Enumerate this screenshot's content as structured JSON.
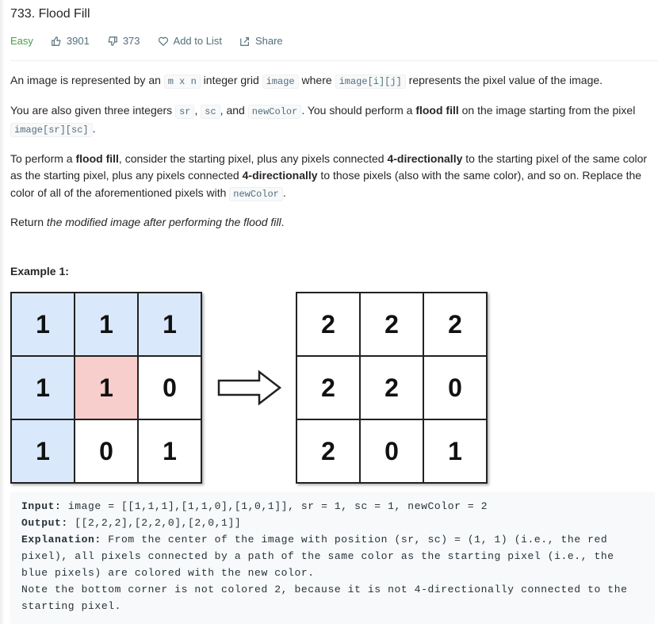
{
  "problem": {
    "title": "733. Flood Fill",
    "difficulty": "Easy",
    "likes": "3901",
    "dislikes": "373",
    "add_to_list": "Add to List",
    "share": "Share"
  },
  "description": {
    "p1": [
      "An image is represented by an ",
      "m x n",
      " integer grid ",
      "image",
      " where ",
      "image[i][j]",
      " represents the pixel value of the image."
    ],
    "p2": [
      "You are also given three integers ",
      "sr",
      ", ",
      "sc",
      ", and ",
      "newColor",
      ". You should perform a ",
      "flood fill",
      " on the image starting from the pixel ",
      "image[sr][sc]",
      "."
    ],
    "p3": [
      "To perform a ",
      "flood fill",
      ", consider the starting pixel, plus any pixels connected ",
      "4-directionally",
      " to the starting pixel of the same color as the starting pixel, plus any pixels connected ",
      "4-directionally",
      " to those pixels (also with the same color), and so on. Replace the color of all of the aforementioned pixels with ",
      "newColor",
      "."
    ],
    "p4": [
      "Return ",
      "the modified image after performing the flood fill",
      "."
    ]
  },
  "example": {
    "heading": "Example 1:",
    "before": [
      [
        "1",
        "1",
        "1"
      ],
      [
        "1",
        "1",
        "0"
      ],
      [
        "1",
        "0",
        "1"
      ]
    ],
    "before_colors": [
      [
        "b",
        "b",
        "b"
      ],
      [
        "b",
        "r",
        ""
      ],
      [
        "b",
        "",
        ""
      ]
    ],
    "after": [
      [
        "2",
        "2",
        "2"
      ],
      [
        "2",
        "2",
        "0"
      ],
      [
        "2",
        "0",
        "1"
      ]
    ],
    "input_label": "Input:",
    "input": " image = [[1,1,1],[1,1,0],[1,0,1]], sr = 1, sc = 1, newColor = 2",
    "output_label": "Output:",
    "output": " [[2,2,2],[2,2,0],[2,0,1]]",
    "explanation_label": "Explanation:",
    "explanation": " From the center of the image with position (sr, sc) = (1, 1) (i.e., the red pixel), all pixels connected by a path of the same color as the starting pixel (i.e., the blue pixels) are colored with the new color.",
    "note": "Note the bottom corner is not colored 2, because it is not 4-directionally connected to the starting pixel."
  },
  "colors": {
    "easy": "#43a047",
    "blue": "#dae8fc",
    "red": "#f8cecc"
  }
}
